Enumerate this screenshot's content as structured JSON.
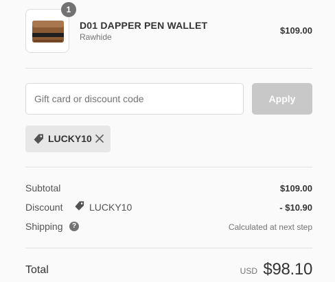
{
  "cart": {
    "items": [
      {
        "quantity": "1",
        "name": "D01 DAPPER PEN WALLET",
        "variant": "Rawhide",
        "price": "$109.00"
      }
    ]
  },
  "discount": {
    "placeholder": "Gift card or discount code",
    "value": "",
    "apply_label": "Apply",
    "applied_code": "LUCKY10"
  },
  "summary": {
    "subtotal_label": "Subtotal",
    "subtotal_value": "$109.00",
    "discount_label": "Discount",
    "discount_code": "LUCKY10",
    "discount_value": "- $10.90",
    "shipping_label": "Shipping",
    "shipping_help_glyph": "?",
    "shipping_value": "Calculated at next step",
    "total_label": "Total",
    "currency": "USD",
    "total_value": "$98.10"
  },
  "colors": {
    "badge": "#727272",
    "apply_disabled": "#c8c8c8",
    "chip_bg": "#e7e7e7"
  }
}
